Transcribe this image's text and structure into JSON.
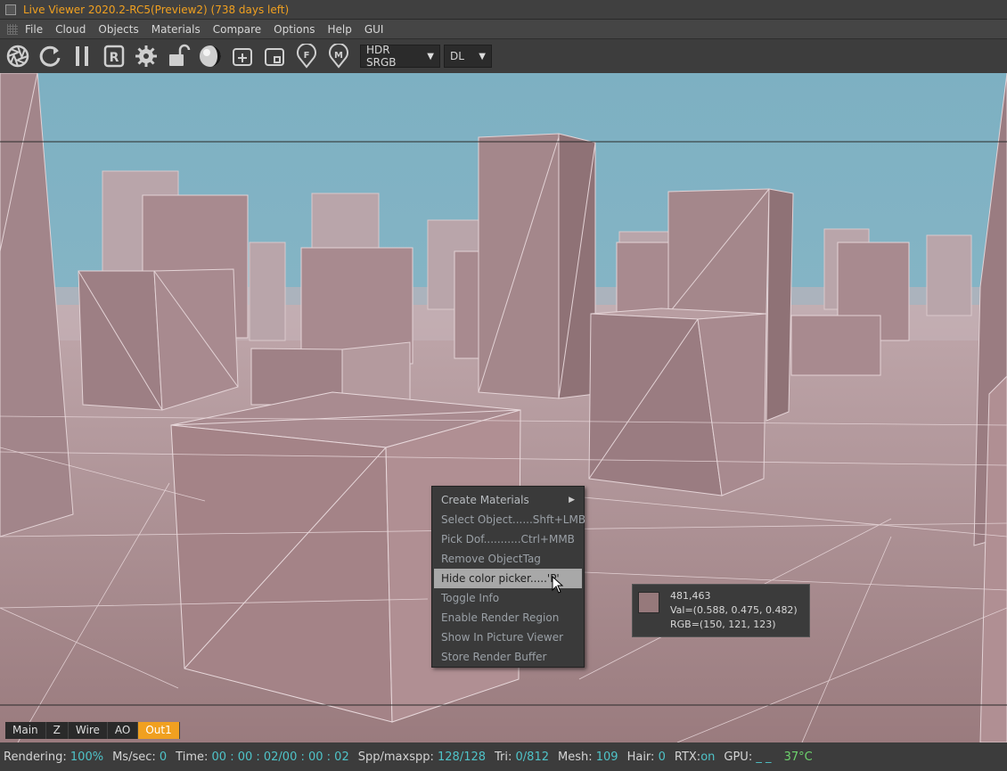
{
  "window": {
    "title": "Live Viewer 2020.2-RC5(Preview2) (738 days left)"
  },
  "menu": [
    "File",
    "Cloud",
    "Objects",
    "Materials",
    "Compare",
    "Options",
    "Help",
    "GUI"
  ],
  "toolbar": {
    "icons": [
      "aperture-icon",
      "refresh-icon",
      "pause-icon",
      "r-icon",
      "gear-icon",
      "unlock-icon",
      "sphere-icon",
      "zoom-region-plus-icon",
      "zoom-region-minus-icon",
      "focus-pin-icon",
      "material-pin-icon"
    ],
    "colorspace_select": "HDR SRGB",
    "kernel_select": "DL"
  },
  "context_menu": {
    "items": [
      "Create Materials",
      "Select Object......Shft+LMB",
      "Pick Dof...........Ctrl+MMB",
      "Remove ObjectTag",
      "Hide color picker.....'P'",
      "Toggle Info",
      "Enable Render Region",
      "Show In Picture Viewer",
      "Store Render Buffer"
    ],
    "highlighted_index": 4
  },
  "color_picker": {
    "coords": "481,463",
    "val": "Val=(0.588, 0.475, 0.482)",
    "rgb": "RGB=(150, 121, 123)",
    "swatch_color": "#96797b"
  },
  "buffer_tabs": [
    "Main",
    "Z",
    "Wire",
    "AO",
    "Out1"
  ],
  "active_buffer": "Out1",
  "status": {
    "rendering_label": "Rendering:",
    "rendering": "100%",
    "mssec_label": "Ms/sec:",
    "mssec": "0",
    "time_label": "Time:",
    "time": "00 : 00 : 02/00 : 00 : 02",
    "spp_label": "Spp/maxspp:",
    "spp": "128/128",
    "tri_label": "Tri:",
    "tri": "0/812",
    "mesh_label": "Mesh:",
    "mesh": "109",
    "hair_label": "Hair:",
    "hair": "0",
    "rtx_label": "RTX:",
    "rtx": "on",
    "gpu_label": "GPU:",
    "gpu": "_ _",
    "temp": "37°C"
  },
  "colors": {
    "accent": "#f0a020",
    "status_value": "#4fc3c8",
    "temp_ok": "#6dd36d",
    "sky": "#7fb3c4",
    "ground": "#a88a8c"
  }
}
